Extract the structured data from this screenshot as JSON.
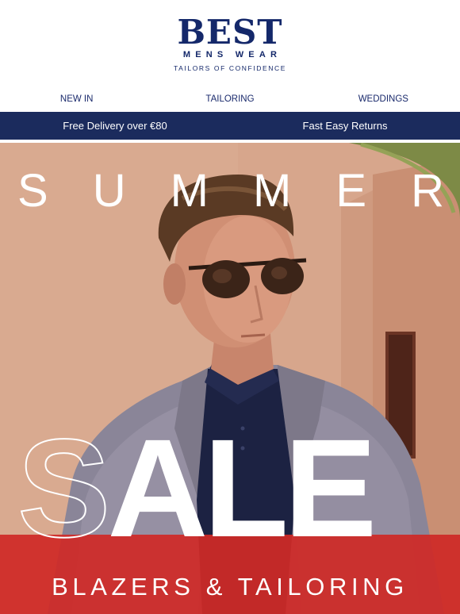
{
  "logo": {
    "brand": "BEST",
    "sub": "MENS WEAR",
    "tagline": "TAILORS OF CONFIDENCE"
  },
  "nav": {
    "items": [
      "NEW IN",
      "TAILORING",
      "WEDDINGS"
    ]
  },
  "promo": {
    "left": "Free Delivery over €80",
    "right": "Fast Easy Returns"
  },
  "hero": {
    "headline_letters": [
      "S",
      "U",
      "M",
      "M",
      "E",
      "R"
    ],
    "headline": "SUMMER",
    "sale_outline_letter": "S",
    "sale_rest": "ALE",
    "subline": "BLAZERS & TAILORING"
  },
  "colors": {
    "navy": "#14286a",
    "promo_bar": "#1b2b5d",
    "sale_red": "#cf2a27",
    "wall": "#d6a48a"
  }
}
